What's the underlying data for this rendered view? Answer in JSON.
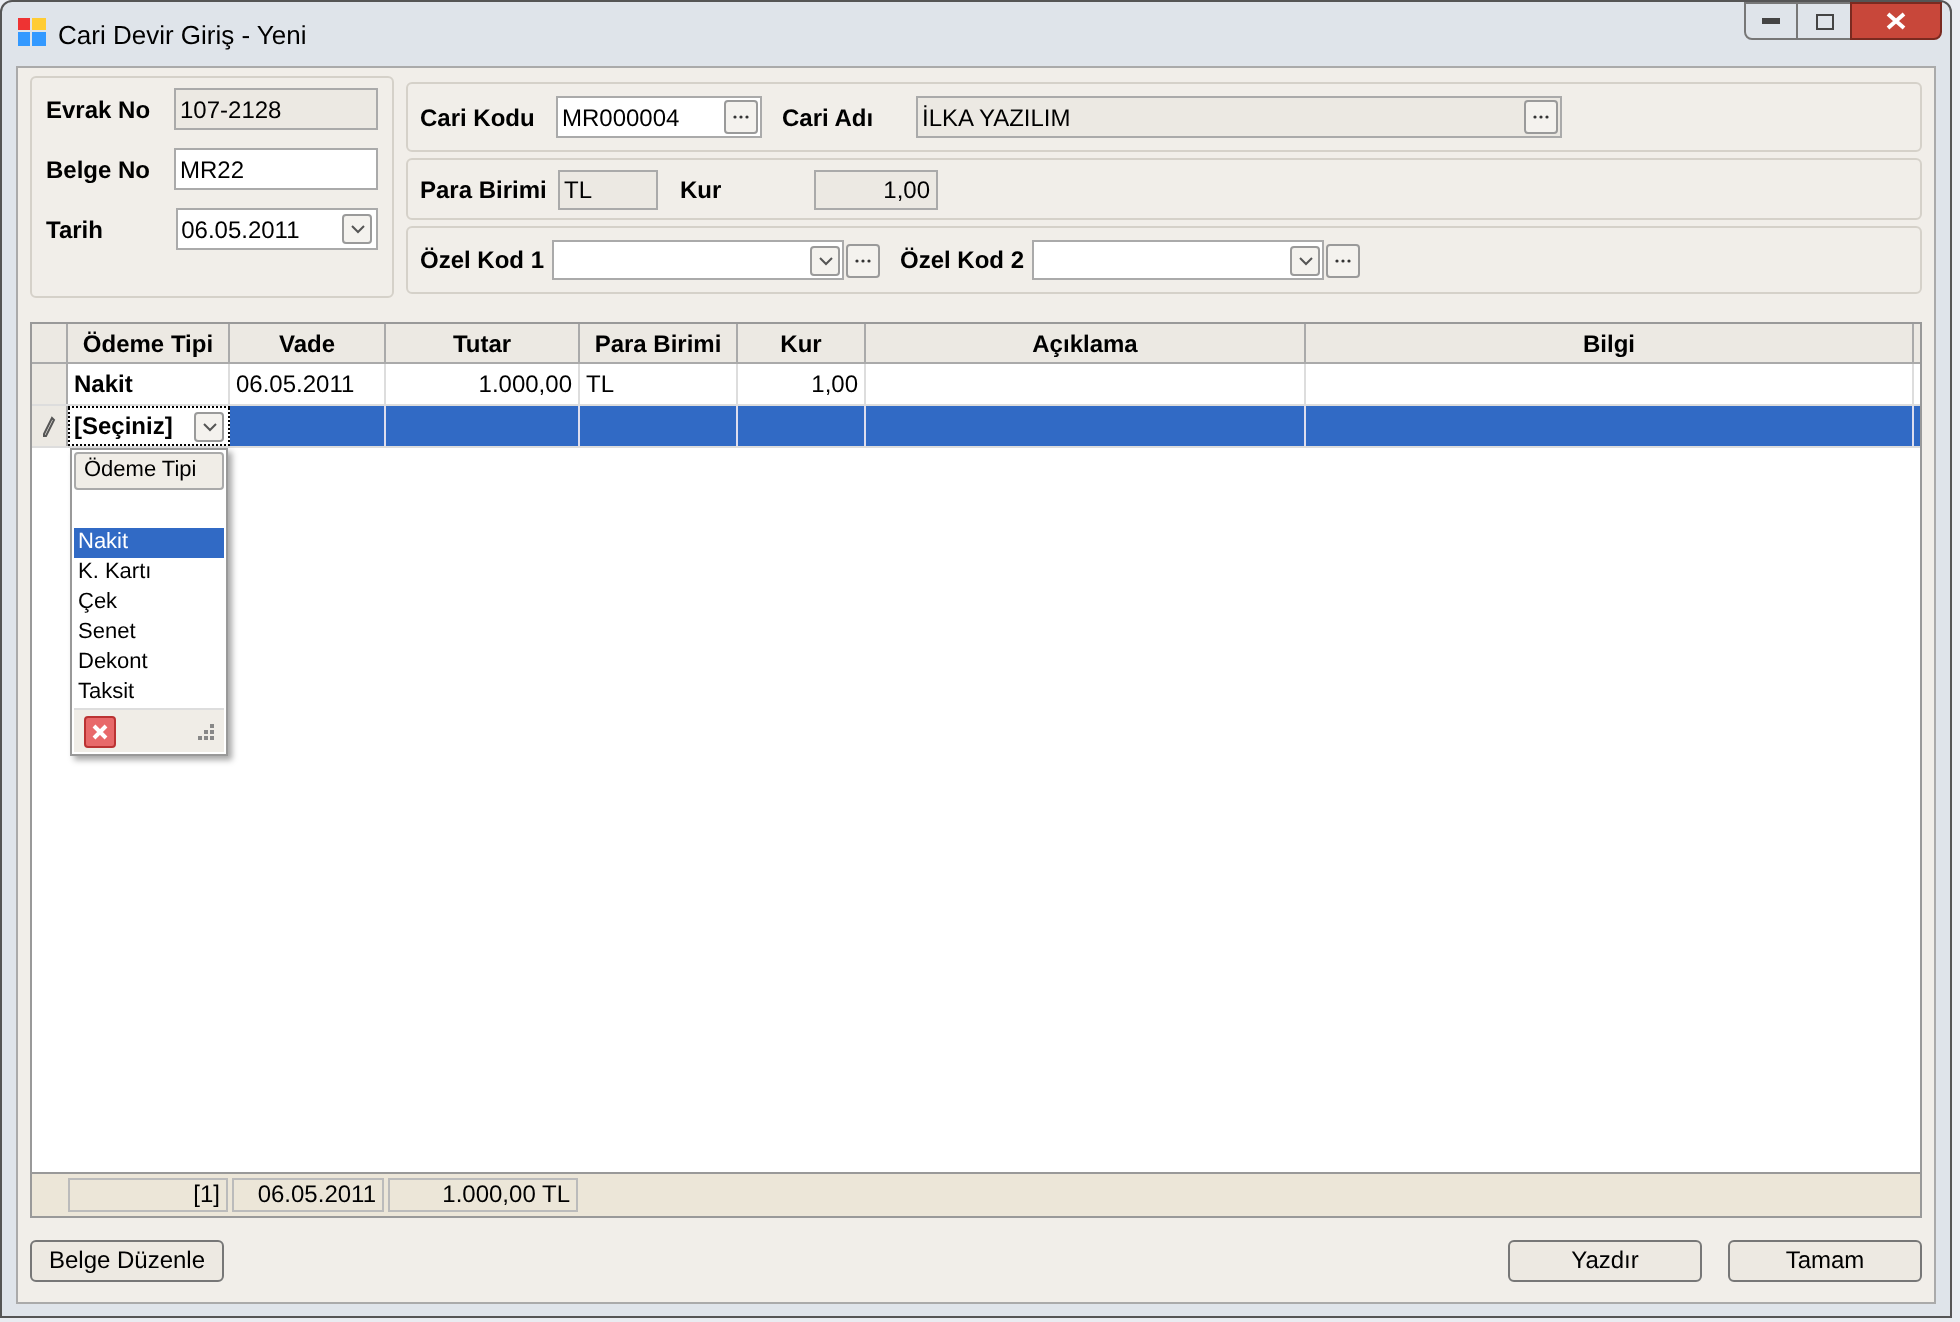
{
  "window": {
    "title": "Cari Devir Giriş - Yeni"
  },
  "left_panel": [
    {
      "label": "Evrak No",
      "value": "107-2128",
      "kind": "readonly"
    },
    {
      "label": "Belge No",
      "value": "MR22",
      "kind": "text"
    },
    {
      "label": "Tarih",
      "value": "06.05.2011",
      "kind": "date"
    }
  ],
  "cari": {
    "code_label": "Cari Kodu",
    "code": "MR000004",
    "name_label": "Cari Adı",
    "name": "İLKA YAZILIM"
  },
  "currency": {
    "label": "Para Birimi",
    "value": "TL",
    "rate_label": "Kur",
    "rate": "1,00"
  },
  "special_codes": [
    {
      "label": "Özel Kod 1"
    },
    {
      "label": "Özel Kod 2"
    }
  ],
  "grid": {
    "columns": [
      "Ödeme Tipi",
      "Vade",
      "Tutar",
      "Para Birimi",
      "Kur",
      "Açıklama",
      "Bilgi"
    ],
    "rows": [
      {
        "selected": false,
        "cells": [
          "Nakit",
          "06.05.2011",
          "1.000,00",
          "TL",
          "1,00"
        ]
      },
      {
        "selected": true,
        "cells": [
          "[Seçiniz]"
        ]
      }
    ],
    "dropdown": {
      "header": "Ödeme Tipi",
      "items": [
        {
          "label": "Nakit",
          "selected": true
        },
        {
          "label": "K. Kartı",
          "selected": false
        },
        {
          "label": "Çek",
          "selected": false
        },
        {
          "label": "Senet",
          "selected": false
        },
        {
          "label": "Dekont",
          "selected": false
        },
        {
          "label": "Taksit",
          "selected": false
        }
      ]
    },
    "footer": [
      "[1]",
      "06.05.2011",
      "1.000,00 TL"
    ]
  },
  "buttons": {
    "left": [
      "Belge Düzenle"
    ],
    "right": [
      "Yazdır",
      "Tamam"
    ]
  }
}
